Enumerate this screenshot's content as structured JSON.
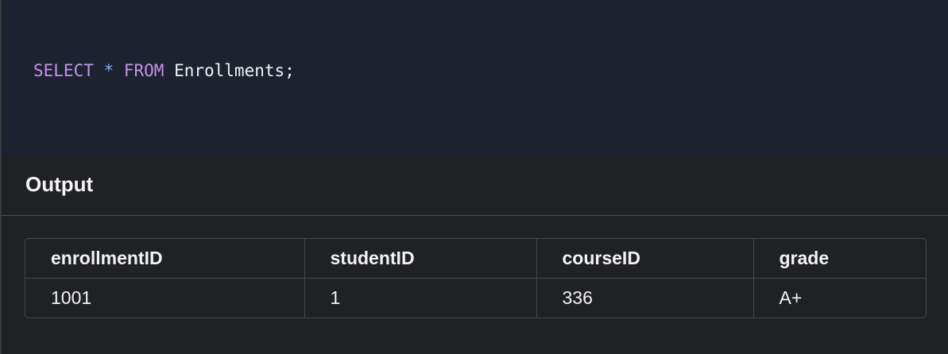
{
  "code": {
    "tokens": {
      "select": "SELECT",
      "star": "*",
      "from": "FROM",
      "table": "Enrollments;"
    }
  },
  "output": {
    "title": "Output",
    "columns": [
      "enrollmentID",
      "studentID",
      "courseID",
      "grade"
    ],
    "rows": [
      [
        "1001",
        "1",
        "336",
        "A+"
      ]
    ]
  },
  "colors": {
    "code_bg": "#1d2230",
    "output_bg": "#202124",
    "keyword": "#c792ea",
    "operator": "#82aaff",
    "border": "#46474b"
  }
}
